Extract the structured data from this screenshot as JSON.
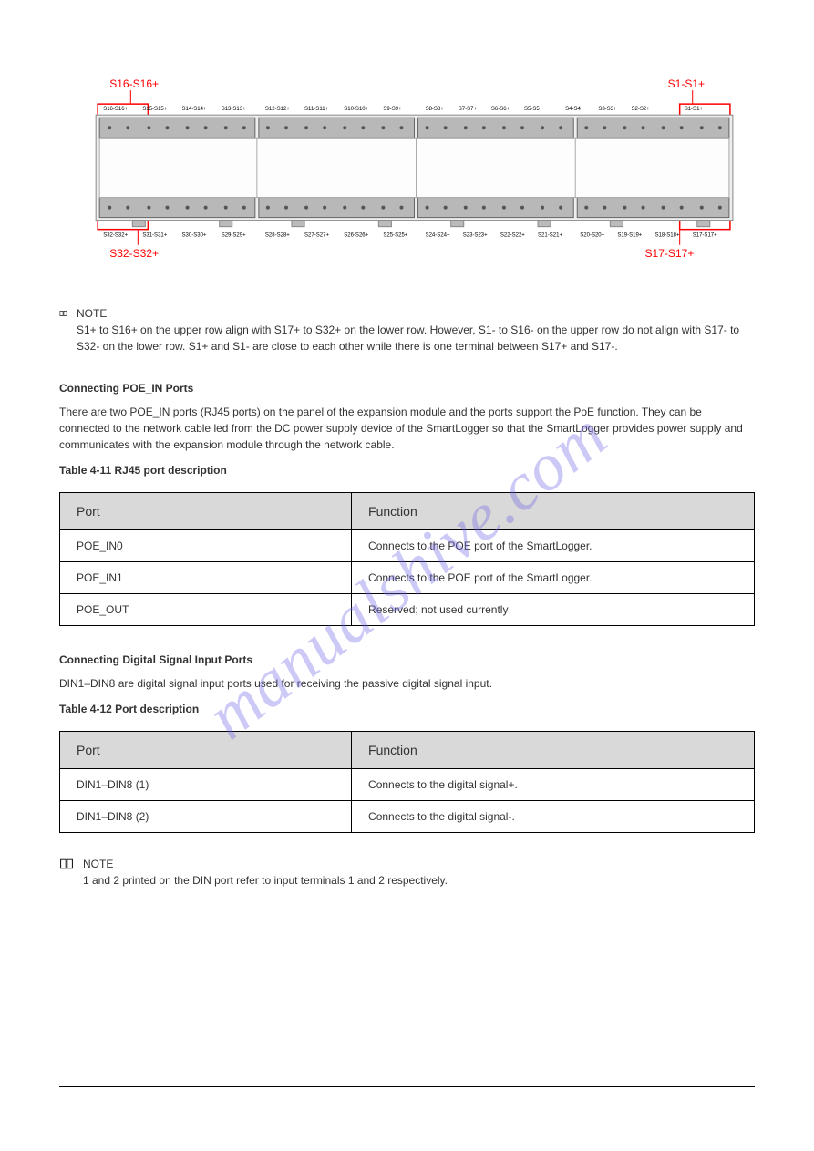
{
  "watermark": "manualshive.com",
  "note1": {
    "heading": "NOTE",
    "text": "S1+ to S16+ on the upper row align with S17+ to S32+ on the lower row. However, S1- to S16- on the upper row do not align with S17- to S32- on the lower row. S1+ and S1- are close to each other while there is one terminal between S17+ and S17-."
  },
  "section1_heading": "Connecting POE_IN Ports",
  "section1_text": "There are two POE_IN ports (RJ45 ports) on the panel of the expansion module and the ports support the PoE function. They can be connected to the network cable led from the DC power supply device of the SmartLogger so that the SmartLogger provides power supply and communicates with the expansion module through the network cable.",
  "table1_caption": "Table 4-11 RJ45 port description",
  "table1": {
    "headers": [
      "Port",
      "Function"
    ],
    "rows": [
      [
        "POE_IN0",
        "Connects to the POE port of the SmartLogger."
      ],
      [
        "POE_IN1",
        "Connects to the POE port of the SmartLogger."
      ],
      [
        "POE_OUT",
        "Reserved; not used currently"
      ]
    ]
  },
  "section2_heading": "Connecting Digital Signal Input Ports",
  "section2_text": "DIN1–DIN8 are digital signal input ports used for receiving the passive digital signal input.",
  "table2_caption": "Table 4-12 Port description",
  "table2": {
    "headers": [
      "Port",
      "Function"
    ],
    "rows": [
      [
        "DIN1–DIN8 (1)",
        "Connects to the digital signal+."
      ],
      [
        "DIN1–DIN8 (2)",
        "Connects to the digital signal-."
      ]
    ]
  },
  "note2": {
    "heading": "NOTE",
    "text": "1 and 2 printed on the DIN port refer to input terminals 1 and 2 respectively."
  },
  "diagram": {
    "labels": {
      "top_left": "S16-S16+",
      "top_right": "S1-S1+",
      "bottom_left": "S32-S32+",
      "bottom_right": "S17-S17+"
    },
    "top_row_labels": [
      "S16-S16+",
      "S15-S15+",
      "S14-S14+",
      "S13-S13+",
      "S12-S12+",
      "S11-S11+",
      "S10-S10+",
      "S9-S9+",
      "S8-S8+",
      "S7-S7+",
      "S6-S6+",
      "S5-S5+",
      "S4-S4+",
      "S3-S3+",
      "S2-S2+",
      "S1-S1+"
    ],
    "bottom_row_labels": [
      "S32-S32+",
      "S31-S31+",
      "S30-S30+",
      "S29-S29+",
      "S28-S28+",
      "S27-S27+",
      "S26-S26+",
      "S25-S25+",
      "S24-S24+",
      "S23-S23+",
      "S22-S22+",
      "S21-S21+",
      "S20-S20+",
      "S19-S19+",
      "S18-S18+",
      "S17-S17+"
    ]
  }
}
